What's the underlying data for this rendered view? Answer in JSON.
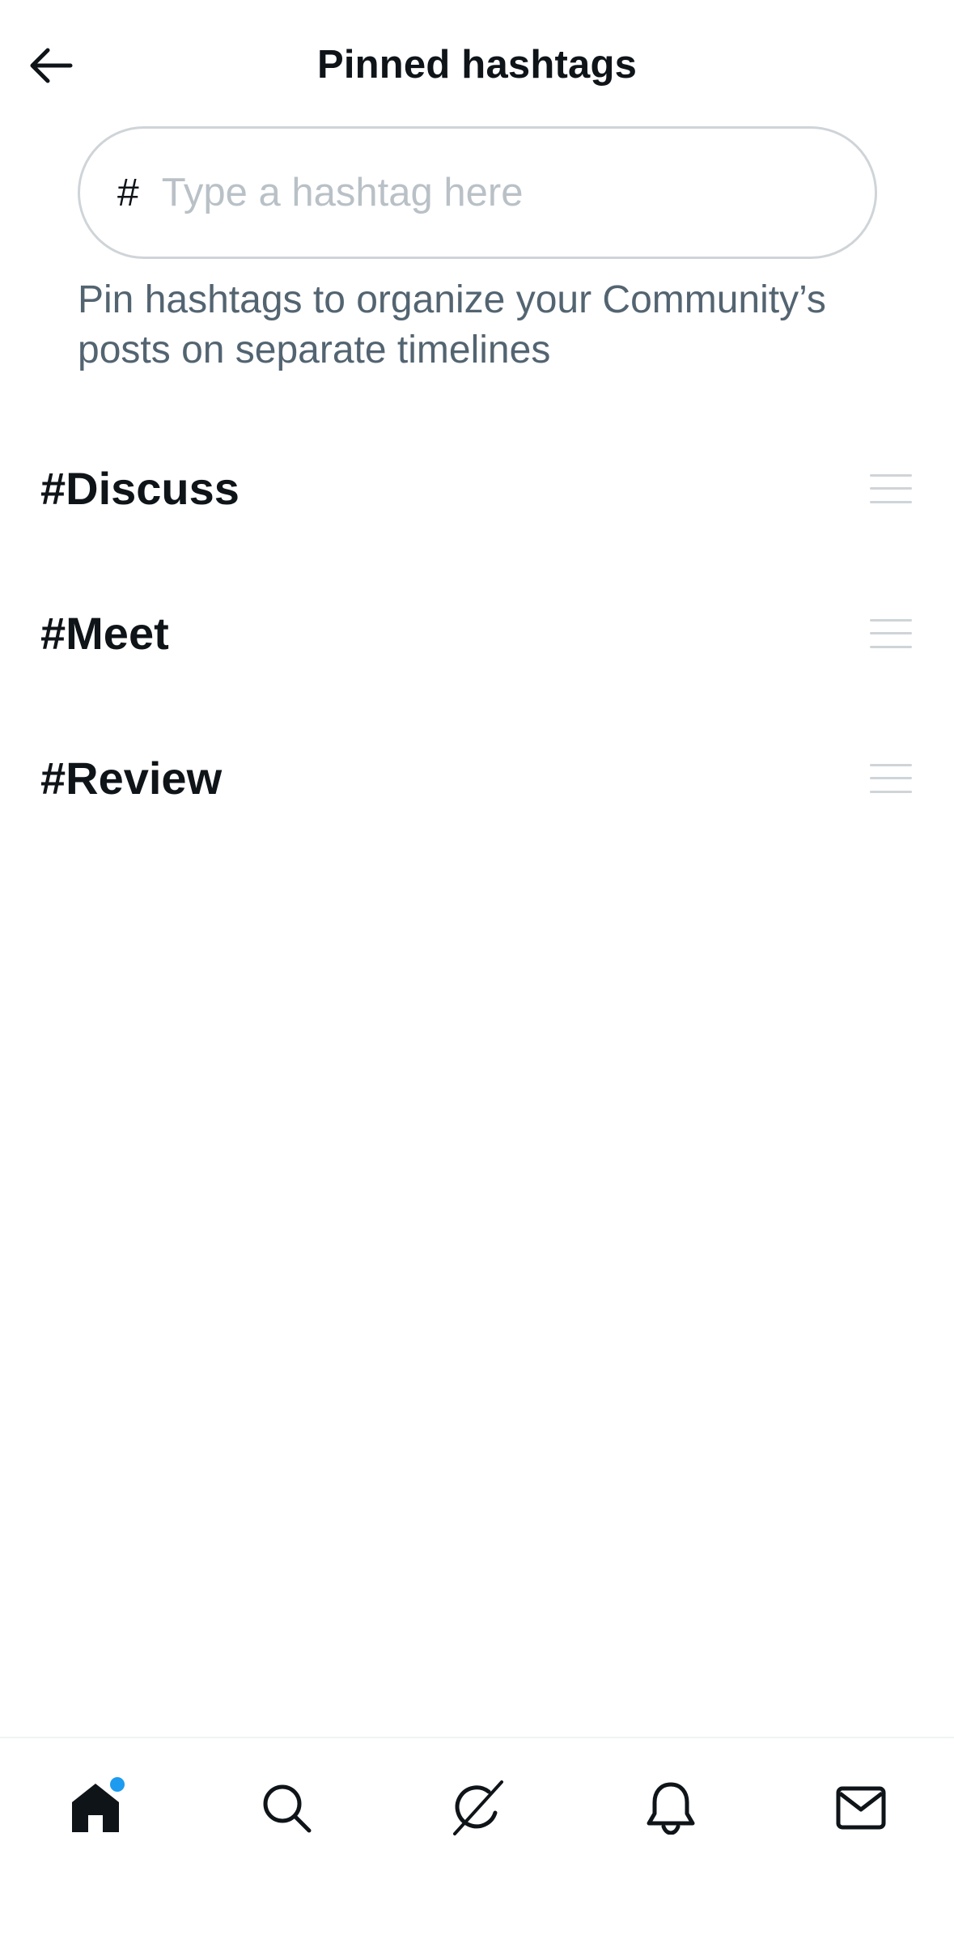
{
  "header": {
    "back_icon": "arrow-left-icon",
    "title": "Pinned hashtags"
  },
  "input": {
    "prefix": "#",
    "placeholder": "Type a hashtag here",
    "value": ""
  },
  "helper_text": "Pin hashtags to organize your Community’s posts on separate timelines",
  "hashtags": [
    {
      "label": "#Discuss"
    },
    {
      "label": "#Meet"
    },
    {
      "label": "#Review"
    }
  ],
  "bottom_nav": {
    "items": [
      {
        "name": "home",
        "icon": "home-icon",
        "active": true,
        "notification_dot": true
      },
      {
        "name": "search",
        "icon": "search-icon",
        "active": false
      },
      {
        "name": "grok",
        "icon": "grok-icon",
        "active": false
      },
      {
        "name": "notifications",
        "icon": "bell-icon",
        "active": false
      },
      {
        "name": "messages",
        "icon": "mail-icon",
        "active": false
      }
    ]
  },
  "colors": {
    "text_primary": "#0f1419",
    "text_secondary": "#536471",
    "placeholder": "#b9c1c7",
    "border": "#cfd4d8",
    "accent": "#1d9bf0"
  }
}
